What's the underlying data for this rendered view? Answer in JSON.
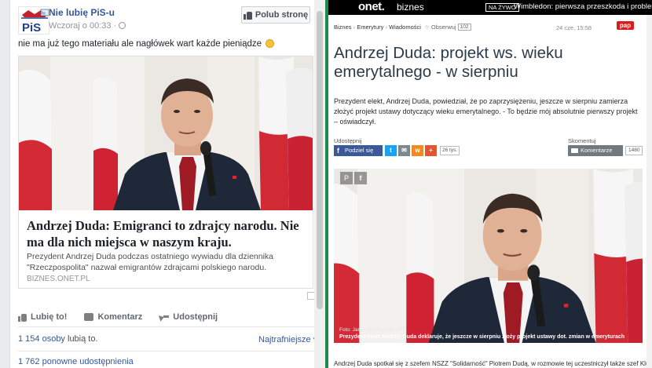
{
  "facebook": {
    "page_name": "Nie lubię PiS-u",
    "time": "Wczoraj o 00:33 ·",
    "like_page_label": "Polub stronę",
    "post_text": "nie ma już tego materiału ale nagłówek wart każde pieniądze",
    "link": {
      "title": "Andrzej Duda: Emigranci to zdrajcy narodu. Nie ma dla nich miejsca w naszym kraju.",
      "description": "Prezydent Andrzej Duda podczas ostatniego wywiadu dla dziennika \"Rzeczpospolita\" nazwał emigrantów zdrajcami polskiego narodu.",
      "domain": "BIZNES.ONET.PL"
    },
    "actions": {
      "like": "Lubię to!",
      "comment": "Komentarz",
      "share": "Udostępnij"
    },
    "likes_count": "1 154 osoby",
    "likes_suffix": " lubią to.",
    "sort_label": "Najtrafniejsze ▾",
    "shares": "1 762 ponowne udostępnienia",
    "avatar_text": "PiS",
    "avatar_badge": "lu"
  },
  "onet": {
    "logo": "onet",
    "logo_sub": "biznes",
    "live_badge": "NA ŻYWO",
    "ticker": "Wimbledon: pierwsza przeszkoda i problemy n",
    "breadcrumb": [
      "Biznes",
      "Emerytury",
      "Wiadomości"
    ],
    "observe_label": "Obserwuj",
    "observe_count": "102",
    "date": "24 cze, 15:58",
    "source_badge": "pap",
    "title": "Andrzej Duda: projekt ws. wieku emerytalnego - w sierpniu",
    "lead": "Prezydent elekt, Andrzej Duda, powiedział, że po zaprzysiężeniu, jeszcze w sierpniu zamierza złożyć projekt ustawy dotyczący wieku emerytalnego. - To będzie mój absolutnie pierwszy projekt – oświadczył.",
    "share_label": "Udostępnij",
    "fb_share_label": "Podziel się",
    "share_count": "26 tys.",
    "comments_label": "Skomentuj",
    "comment_button_label": "Komentarze",
    "comment_count": "1480",
    "photo_credit": "Foto: Janek Skarżyński / AFP",
    "photo_caption": "Prezydent elekt Andrzej Duda deklaruje, że jeszcze w sierpniu złoży projekt ustawy dot. zmian w emeryturach",
    "body_start": "Andrzej Duda spotkał się z szefem NSZZ \"Solidarność\" Piotrem Dudą, w rozmowie tej uczestniczył także szef Klu"
  }
}
